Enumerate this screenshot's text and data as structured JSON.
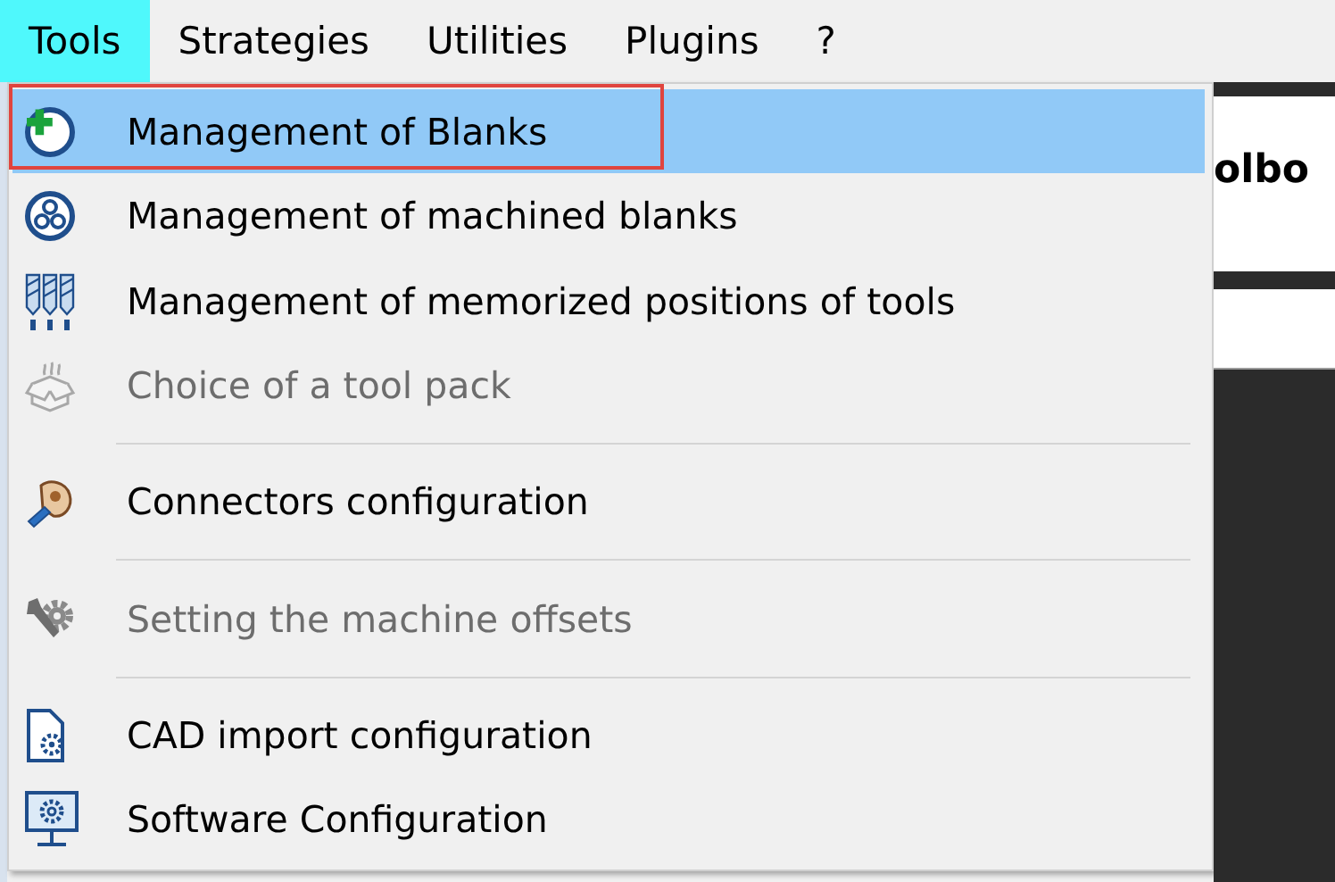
{
  "menubar": [
    {
      "label": "Tools",
      "selected": true
    },
    {
      "label": "Strategies",
      "selected": false
    },
    {
      "label": "Utilities",
      "selected": false
    },
    {
      "label": "Plugins",
      "selected": false
    },
    {
      "label": "?",
      "selected": false
    }
  ],
  "background_window": {
    "heading": "olbo"
  },
  "menu": [
    {
      "kind": "item",
      "label": "Management of Blanks",
      "selected": true,
      "disabled": false,
      "outlined": true
    },
    {
      "kind": "item",
      "label": "Management of machined blanks",
      "selected": false,
      "disabled": false,
      "outlined": false
    },
    {
      "kind": "item",
      "label": "Management of memorized positions of tools",
      "selected": false,
      "disabled": false,
      "outlined": false
    },
    {
      "kind": "item",
      "label": "Choice of a tool pack",
      "selected": false,
      "disabled": true,
      "outlined": false
    },
    {
      "kind": "separator"
    },
    {
      "kind": "item",
      "label": "Connectors configuration",
      "selected": false,
      "disabled": false,
      "outlined": false
    },
    {
      "kind": "separator"
    },
    {
      "kind": "item",
      "label": "Setting the machine offsets",
      "selected": false,
      "disabled": true,
      "outlined": false
    },
    {
      "kind": "separator"
    },
    {
      "kind": "item",
      "label": "CAD import configuration",
      "selected": false,
      "disabled": false,
      "outlined": false
    },
    {
      "kind": "item",
      "label": "Software Configuration",
      "selected": false,
      "disabled": false,
      "outlined": false
    }
  ]
}
